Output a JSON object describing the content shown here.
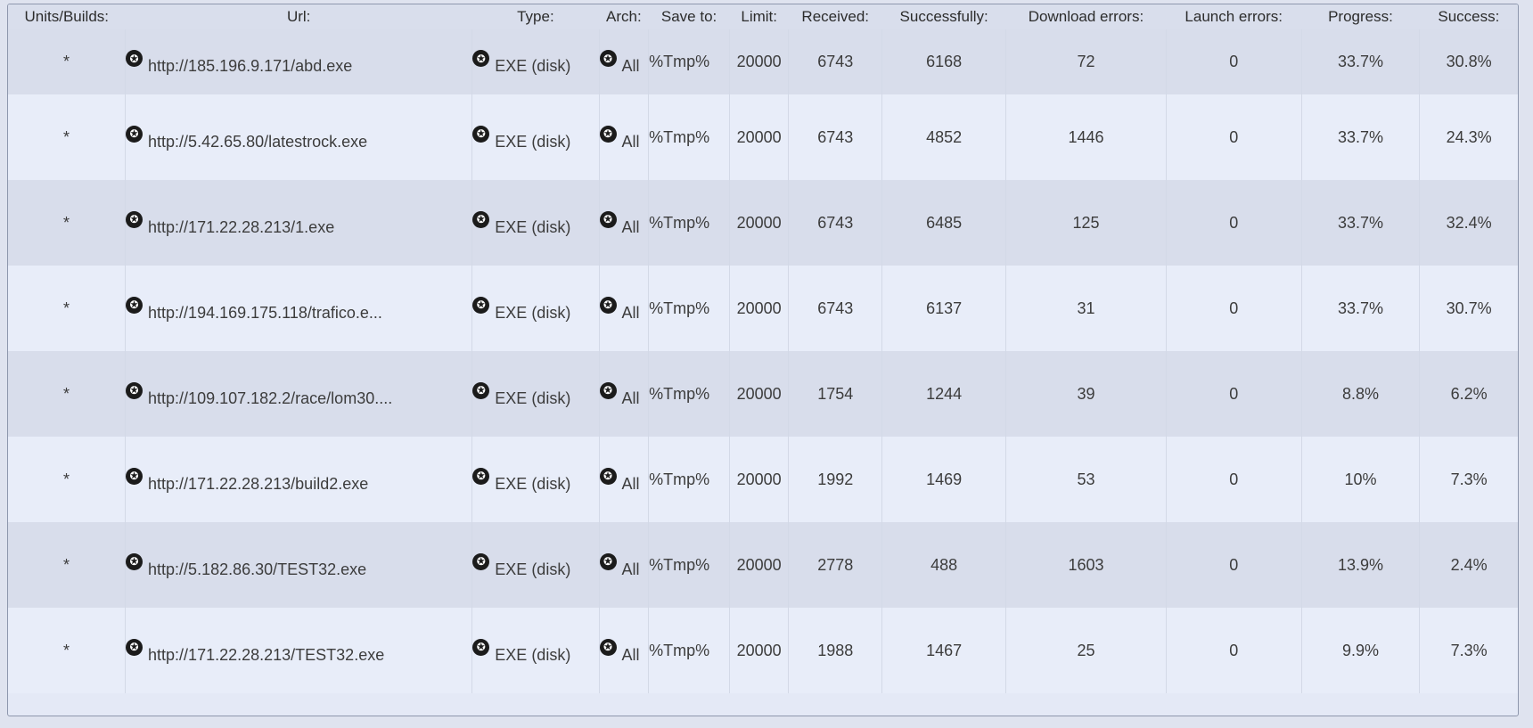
{
  "columns": {
    "units": "Units/Builds:",
    "url": "Url:",
    "type": "Type:",
    "arch": "Arch:",
    "save_to": "Save to:",
    "limit": "Limit:",
    "received": "Received:",
    "successfully": "Successfully:",
    "download_errors": "Download errors:",
    "launch_errors": "Launch errors:",
    "progress": "Progress:",
    "success": "Success:"
  },
  "rows": [
    {
      "units": "*",
      "url": "http://185.196.9.171/abd.exe",
      "type": "EXE (disk)",
      "arch": "All",
      "save_to": "%Tmp%",
      "limit": "20000",
      "received": "6743",
      "successfully": "6168",
      "download_errors": "72",
      "launch_errors": "0",
      "progress": "33.7%",
      "success": "30.8%"
    },
    {
      "units": "*",
      "url": "http://5.42.65.80/latestrock.exe",
      "type": "EXE (disk)",
      "arch": "All",
      "save_to": "%Tmp%",
      "limit": "20000",
      "received": "6743",
      "successfully": "4852",
      "download_errors": "1446",
      "launch_errors": "0",
      "progress": "33.7%",
      "success": "24.3%"
    },
    {
      "units": "*",
      "url": "http://171.22.28.213/1.exe",
      "type": "EXE (disk)",
      "arch": "All",
      "save_to": "%Tmp%",
      "limit": "20000",
      "received": "6743",
      "successfully": "6485",
      "download_errors": "125",
      "launch_errors": "0",
      "progress": "33.7%",
      "success": "32.4%"
    },
    {
      "units": "*",
      "url": "http://194.169.175.118/trafico.e...",
      "type": "EXE (disk)",
      "arch": "All",
      "save_to": "%Tmp%",
      "limit": "20000",
      "received": "6743",
      "successfully": "6137",
      "download_errors": "31",
      "launch_errors": "0",
      "progress": "33.7%",
      "success": "30.7%"
    },
    {
      "units": "*",
      "url": "http://109.107.182.2/race/lom30....",
      "type": "EXE (disk)",
      "arch": "All",
      "save_to": "%Tmp%",
      "limit": "20000",
      "received": "1754",
      "successfully": "1244",
      "download_errors": "39",
      "launch_errors": "0",
      "progress": "8.8%",
      "success": "6.2%"
    },
    {
      "units": "*",
      "url": "http://171.22.28.213/build2.exe",
      "type": "EXE (disk)",
      "arch": "All",
      "save_to": "%Tmp%",
      "limit": "20000",
      "received": "1992",
      "successfully": "1469",
      "download_errors": "53",
      "launch_errors": "0",
      "progress": "10%",
      "success": "7.3%"
    },
    {
      "units": "*",
      "url": "http://5.182.86.30/TEST32.exe",
      "type": "EXE (disk)",
      "arch": "All",
      "save_to": "%Tmp%",
      "limit": "20000",
      "received": "2778",
      "successfully": "488",
      "download_errors": "1603",
      "launch_errors": "0",
      "progress": "13.9%",
      "success": "2.4%"
    },
    {
      "units": "*",
      "url": "http://171.22.28.213/TEST32.exe",
      "type": "EXE (disk)",
      "arch": "All",
      "save_to": "%Tmp%",
      "limit": "20000",
      "received": "1988",
      "successfully": "1467",
      "download_errors": "25",
      "launch_errors": "0",
      "progress": "9.9%",
      "success": "7.3%"
    }
  ],
  "icons": {
    "glyph": "✪",
    "name": "star-circle-icon"
  }
}
